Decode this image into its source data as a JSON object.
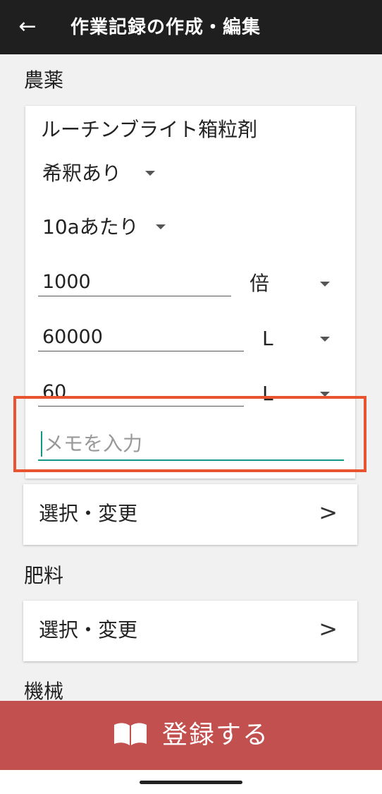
{
  "header": {
    "title": "作業記録の作成・編集",
    "back_icon": "arrow-left-icon"
  },
  "sections": {
    "pesticide": {
      "label": "農薬",
      "entry": {
        "name": "ルーチンブライト箱粒剤",
        "dilution": "希釈あり",
        "basis": "10aあたり",
        "dilution_factor": {
          "value": "1000",
          "unit": "倍"
        },
        "solution_amount": {
          "value": "60000",
          "unit": "L"
        },
        "chemical_amount": {
          "value": "60",
          "unit": "L"
        },
        "memo": {
          "placeholder": "メモを入力",
          "value": ""
        }
      },
      "select_label": "選択・変更",
      "chevron": ">"
    },
    "fertilizer": {
      "label": "肥料",
      "select_label": "選択・変更",
      "chevron": ">"
    },
    "machine": {
      "label": "機械"
    }
  },
  "register_button": {
    "label": "登録する",
    "icon": "book-open-icon"
  },
  "colors": {
    "appbar": "#1f1f1f",
    "accent_teal": "#129886",
    "register": "#c2504f",
    "highlight": "#e8542f",
    "background": "#f1f1f1"
  }
}
